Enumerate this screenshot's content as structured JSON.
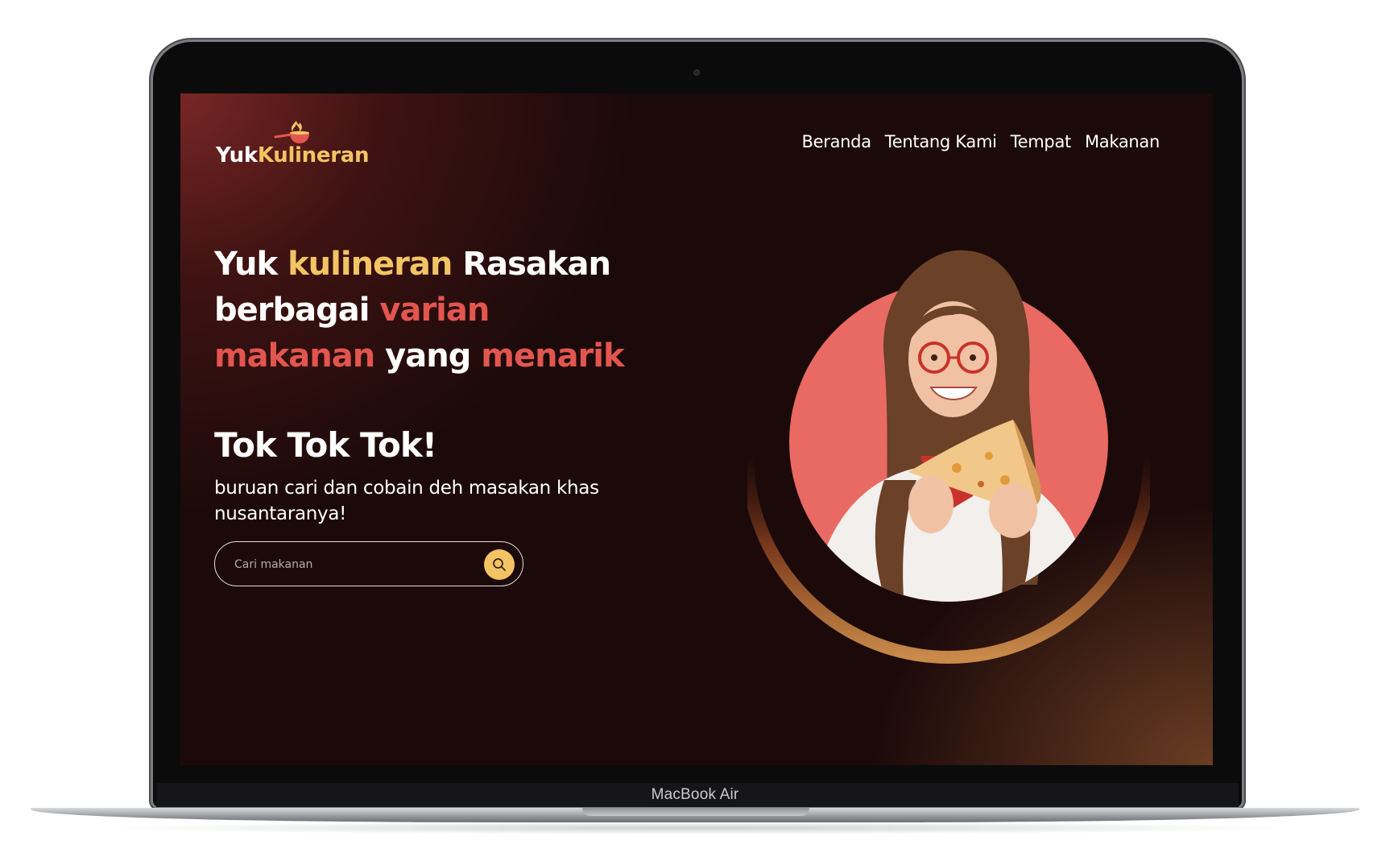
{
  "device": {
    "label": "MacBook Air"
  },
  "site": {
    "logo": {
      "part1": "Yuk",
      "part2": "Kulineran",
      "icon": "wok-fire-icon"
    },
    "nav": [
      {
        "label": "Beranda"
      },
      {
        "label": "Tentang Kami"
      },
      {
        "label": "Tempat"
      },
      {
        "label": "Makanan"
      }
    ],
    "hero": {
      "title_parts": [
        "Yuk",
        "kulineran",
        "Rasakan",
        "berbagai",
        "varian",
        "makanan",
        "yang",
        "menarik"
      ],
      "subtitle": "Tok Tok Tok!",
      "tagline": "buruan cari dan cobain deh masakan khas nusantaranya!",
      "image": "woman-eating-pizza-photo"
    },
    "search": {
      "placeholder": "Cari makanan",
      "value": "",
      "icon": "search-icon"
    }
  },
  "colors": {
    "background": "#1c0a0a",
    "accent_yellow": "#f2c464",
    "accent_red": "#e2564f",
    "circle_coral": "#e86a63",
    "arc_bronze": "#b8743e"
  }
}
